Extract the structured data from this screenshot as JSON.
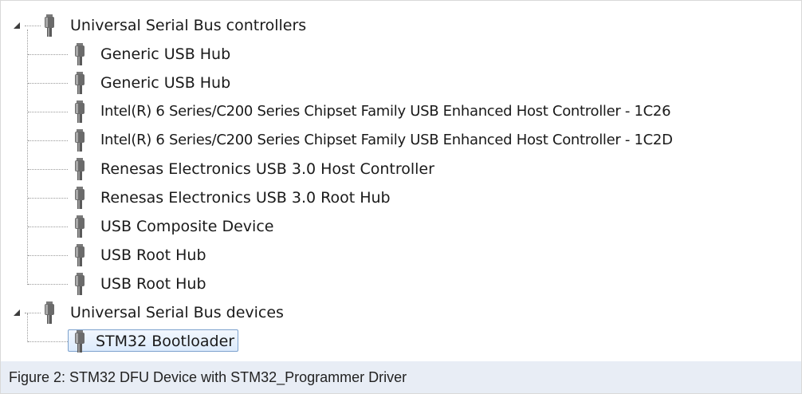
{
  "device_tree": {
    "groups": [
      {
        "label": "Universal Serial Bus controllers",
        "expanded": true,
        "icon": "usb-plug-icon",
        "children": [
          {
            "label": "Generic USB Hub",
            "icon": "usb-plug-icon"
          },
          {
            "label": "Generic USB Hub",
            "icon": "usb-plug-icon"
          },
          {
            "label": "Intel(R) 6 Series/C200 Series Chipset Family USB Enhanced Host Controller - 1C26",
            "icon": "usb-plug-icon"
          },
          {
            "label": "Intel(R) 6 Series/C200 Series Chipset Family USB Enhanced Host Controller - 1C2D",
            "icon": "usb-plug-icon"
          },
          {
            "label": "Renesas Electronics USB 3.0 Host Controller",
            "icon": "usb-plug-icon"
          },
          {
            "label": "Renesas Electronics USB 3.0 Root Hub",
            "icon": "usb-plug-icon"
          },
          {
            "label": "USB Composite Device",
            "icon": "usb-plug-icon"
          },
          {
            "label": "USB Root Hub",
            "icon": "usb-plug-icon"
          },
          {
            "label": "USB Root Hub",
            "icon": "usb-plug-icon"
          }
        ]
      },
      {
        "label": "Universal Serial Bus devices",
        "expanded": true,
        "icon": "usb-plug-icon",
        "children": [
          {
            "label": "STM32 Bootloader",
            "icon": "usb-plug-icon",
            "selected": true
          }
        ]
      }
    ]
  },
  "caption": {
    "text": "Figure 2: STM32 DFU Device with STM32_Programmer Driver"
  },
  "colors": {
    "caption_background": "#e8edf5",
    "selection_border": "#7da2ce",
    "selection_fill": "#dcebfc",
    "tree_line": "#9a9a9a"
  }
}
